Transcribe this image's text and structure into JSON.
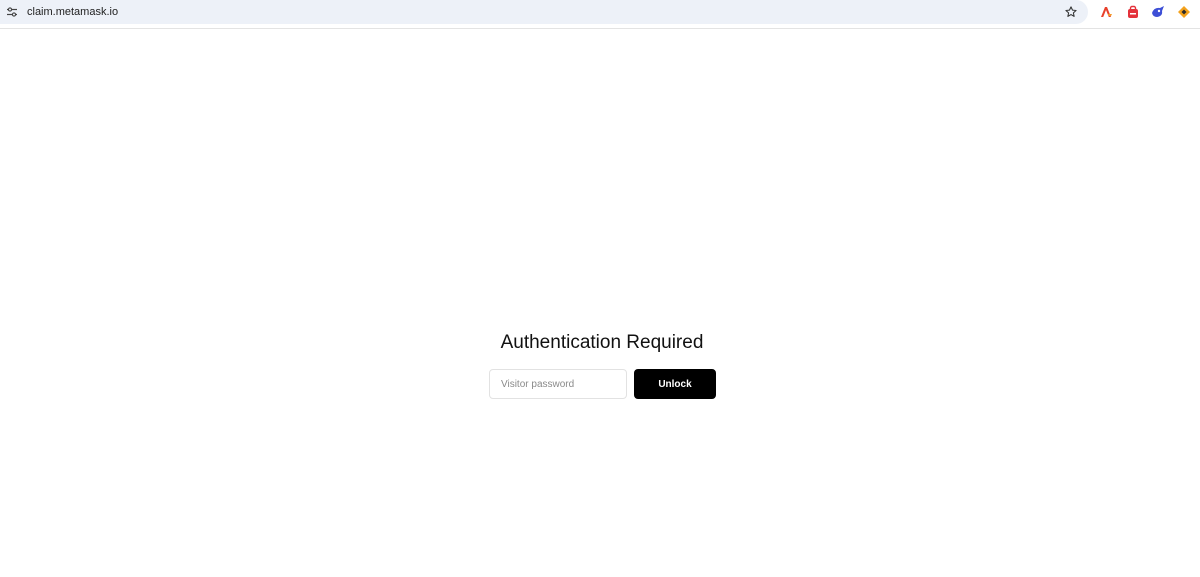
{
  "browser": {
    "url": "claim.metamask.io",
    "icons": {
      "site_info": "tune-icon",
      "bookmark": "star-outline-icon",
      "extensions": [
        "adobe-acrobat-icon",
        "red-extension-icon",
        "blue-extension-icon",
        "orange-extension-icon"
      ]
    }
  },
  "auth": {
    "title": "Authentication Required",
    "password_placeholder": "Visitor password",
    "password_value": "",
    "unlock_label": "Unlock"
  },
  "colors": {
    "omnibox_bg": "#edf1f8",
    "button_bg": "#000000",
    "button_text": "#ffffff",
    "title_text": "#111111"
  }
}
